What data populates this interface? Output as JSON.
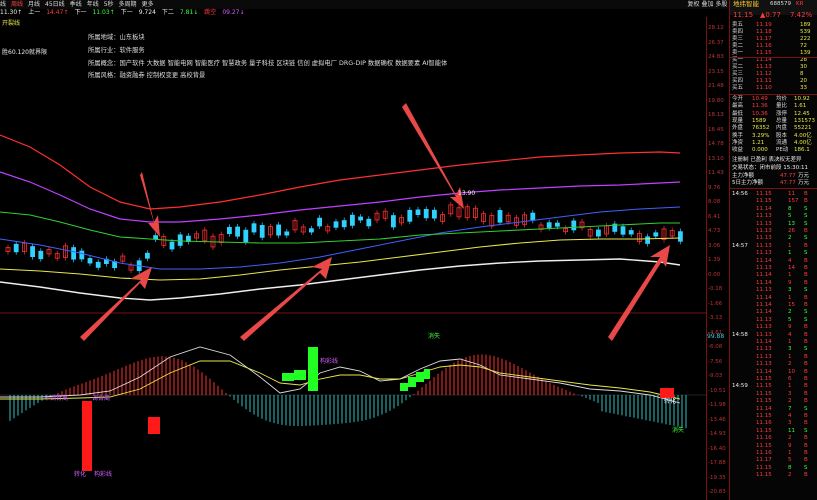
{
  "topbar": {
    "items": [
      "线",
      "周线",
      "月线",
      "45日线",
      "季线",
      "年线",
      "5秒",
      "多周期",
      "更多"
    ],
    "right": "复权 叠加 多股 统计 画线 F10 标记+自选 返回"
  },
  "quote": {
    "items": [
      {
        "t": "11.30↑",
        "c": "white"
      },
      {
        "t": "上一",
        "c": "white"
      },
      {
        "t": "14.47↑",
        "c": "red"
      },
      {
        "t": "下一",
        "c": "white"
      },
      {
        "t": "11.03↑",
        "c": "green"
      },
      {
        "t": "下一",
        "c": "white"
      },
      {
        "t": "9.724",
        "c": "white"
      },
      {
        "t": "下二",
        "c": "white"
      },
      {
        "t": "7.81↓",
        "c": "green"
      },
      {
        "t": "跳空",
        "c": "red"
      },
      {
        "t": "09.27↓",
        "c": "purple"
      }
    ],
    "sub": "开裂线"
  },
  "info": {
    "region": "所属地域：山东板块",
    "industry": "所属行业：软件服务",
    "concept": "所属概念：国产软件 大数据 智能电网 智能医疗 智慧政务 量子科技 区块链 信创 虚拟电厂 DRG-DIP 数据确权 数据要素 AI智能体",
    "style": "所属风格：融资融券 控制权变更 高校背景",
    "left_note": "胜60.120就界限"
  },
  "chart_labels": {
    "high": "13.90",
    "vol_signal_1": "构彩线",
    "vol_signal_2": "消失",
    "vol_signal_3": "消失",
    "vol_signal_4": "转化",
    "vol_left_1": "十调背离",
    "vol_left_2": "调背离",
    "vol_left_3": "转化",
    "vol_left_4": "构彩线",
    "macd_right": "99.88"
  },
  "axis_ticks": [
    "28.12",
    "26.37",
    "24.83",
    "23.15",
    "21.48",
    "19.80",
    "18.13",
    "16.45",
    "14.78",
    "13.10",
    "11.43",
    "9.76",
    "8.08",
    "6.41",
    "4.73",
    "3.06",
    "1.39",
    "0.00",
    "-0.18",
    "-1.66",
    "-3.13",
    "-4.61",
    "-6.08",
    "-7.56",
    "-9.03",
    "-10.51",
    "-11.98",
    "-13.46",
    "-14.93",
    "-16.40",
    "-17.88",
    "-19.35",
    "-20.83"
  ],
  "panel": {
    "title": "地纬智能",
    "code": "688579",
    "badge": "KR",
    "price": "11.15",
    "change": "▲0.77",
    "pct": "7.42%",
    "orderbook": [
      {
        "l": "卖五",
        "p": "11.19",
        "v": "189"
      },
      {
        "l": "卖四",
        "p": "11.18",
        "v": "539"
      },
      {
        "l": "卖三",
        "p": "11.17",
        "v": "222"
      },
      {
        "l": "卖二",
        "p": "11.16",
        "v": "72"
      },
      {
        "l": "卖一",
        "p": "11.15",
        "v": "139"
      },
      {
        "l": "买一",
        "p": "11.14",
        "v": "28"
      },
      {
        "l": "买二",
        "p": "11.13",
        "v": "30"
      },
      {
        "l": "买三",
        "p": "11.12",
        "v": "8"
      },
      {
        "l": "买四",
        "p": "11.11",
        "v": "20"
      },
      {
        "l": "买五",
        "p": "11.10",
        "v": "33"
      }
    ],
    "stats": [
      {
        "a": "今开",
        "av": "10.49",
        "b": "均价",
        "bv": "10.92"
      },
      {
        "a": "最高",
        "av": "11.36",
        "b": "量比",
        "bv": "1.61"
      },
      {
        "a": "最低",
        "av": "10.36",
        "b": "涨停",
        "bv": "12.45"
      },
      {
        "a": "现量",
        "av": "1589",
        "b": "总量",
        "bv": "131573"
      },
      {
        "a": "外盘",
        "av": "76352",
        "b": "内盘",
        "bv": "55221"
      },
      {
        "a": "换手",
        "av": "3.29%",
        "b": "股本",
        "bv": "4.00亿"
      },
      {
        "a": "净资",
        "av": "1.21",
        "b": "流通",
        "bv": "4.00亿"
      },
      {
        "a": "收益",
        "av": "0.000",
        "b": "PE动",
        "bv": "186.1"
      }
    ],
    "notice": "注册制 已盈利 表决权无差异",
    "status": "交易状态：闭市前段 15:30:11",
    "flows": [
      {
        "l": "主力净额",
        "v": "47.77",
        "u": "万元"
      },
      {
        "l": "5日主力净额",
        "v": "47.77",
        "u": "万元"
      }
    ],
    "ticks": [
      {
        "t": "14:56",
        "p": "11.15",
        "v": "11",
        "d": "B"
      },
      {
        "t": "",
        "p": "11.15",
        "v": "157",
        "d": "B"
      },
      {
        "t": "",
        "p": "11.14",
        "v": "8",
        "d": "S"
      },
      {
        "t": "",
        "p": "11.13",
        "v": "5",
        "d": "S"
      },
      {
        "t": "",
        "p": "11.13",
        "v": "13",
        "d": "S"
      },
      {
        "t": "",
        "p": "11.13",
        "v": "26",
        "d": "B"
      },
      {
        "t": "",
        "p": "11.13",
        "v": "2",
        "d": "S"
      },
      {
        "t": "14:57",
        "p": "11.13",
        "v": "1",
        "d": "B"
      },
      {
        "t": "",
        "p": "11.13",
        "v": "1",
        "d": "S"
      },
      {
        "t": "",
        "p": "11.14",
        "v": "4",
        "d": "B"
      },
      {
        "t": "",
        "p": "11.13",
        "v": "14",
        "d": "B"
      },
      {
        "t": "",
        "p": "11.14",
        "v": "1",
        "d": "B"
      },
      {
        "t": "",
        "p": "11.14",
        "v": "9",
        "d": "B"
      },
      {
        "t": "",
        "p": "11.13",
        "v": "3",
        "d": "S"
      },
      {
        "t": "",
        "p": "11.14",
        "v": "1",
        "d": "B"
      },
      {
        "t": "",
        "p": "11.14",
        "v": "15",
        "d": "B"
      },
      {
        "t": "",
        "p": "11.14",
        "v": "2",
        "d": "S"
      },
      {
        "t": "",
        "p": "11.13",
        "v": "5",
        "d": "S"
      },
      {
        "t": "",
        "p": "11.13",
        "v": "9",
        "d": "B"
      },
      {
        "t": "14:58",
        "p": "11.13",
        "v": "4",
        "d": "B"
      },
      {
        "t": "",
        "p": "11.14",
        "v": "1",
        "d": "B"
      },
      {
        "t": "",
        "p": "11.13",
        "v": "3",
        "d": "S"
      },
      {
        "t": "",
        "p": "11.13",
        "v": "1",
        "d": "B"
      },
      {
        "t": "",
        "p": "11.13",
        "v": "2",
        "d": "B"
      },
      {
        "t": "",
        "p": "11.14",
        "v": "10",
        "d": "B"
      },
      {
        "t": "",
        "p": "11.15",
        "v": "6",
        "d": "B"
      },
      {
        "t": "14:59",
        "p": "11.15",
        "v": "1",
        "d": "B"
      },
      {
        "t": "",
        "p": "11.15",
        "v": "3",
        "d": "B"
      },
      {
        "t": "",
        "p": "11.15",
        "v": "2",
        "d": "B"
      },
      {
        "t": "",
        "p": "11.14",
        "v": "7",
        "d": "S"
      },
      {
        "t": "",
        "p": "11.15",
        "v": "4",
        "d": "B"
      },
      {
        "t": "",
        "p": "11.16",
        "v": "3",
        "d": "B"
      },
      {
        "t": "",
        "p": "11.15",
        "v": "11",
        "d": "S"
      },
      {
        "t": "",
        "p": "11.16",
        "v": "2",
        "d": "B"
      },
      {
        "t": "",
        "p": "11.15",
        "v": "9",
        "d": "B"
      },
      {
        "t": "",
        "p": "11.16",
        "v": "1",
        "d": "B"
      },
      {
        "t": "",
        "p": "11.17",
        "v": "5",
        "d": "B"
      },
      {
        "t": "",
        "p": "11.15",
        "v": "8",
        "d": "S"
      },
      {
        "t": "",
        "p": "11.15",
        "v": "2",
        "d": "B"
      }
    ]
  }
}
